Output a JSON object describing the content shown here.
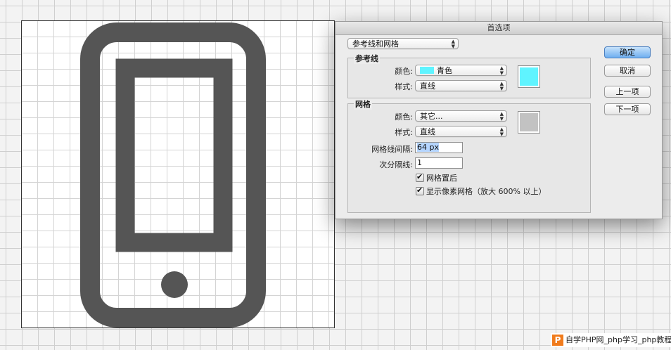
{
  "dialog": {
    "title": "首选项",
    "section_select": "参考线和网格",
    "guides": {
      "title": "参考线",
      "color_label": "颜色:",
      "color_value": "青色",
      "color_swatch": "#5ff4ff",
      "style_label": "样式:",
      "style_value": "直线"
    },
    "grid": {
      "title": "网格",
      "color_label": "颜色:",
      "color_value": "其它...",
      "color_swatch": "#c2c2c2",
      "style_label": "样式:",
      "style_value": "直线",
      "spacing_label": "网格线间隔:",
      "spacing_value": "64 px",
      "subdiv_label": "次分隔线:",
      "subdiv_value": "1",
      "behind_label": "网格置后",
      "pixel_grid_label": "显示像素网格（放大 600% 以上）"
    },
    "buttons": {
      "ok": "确定",
      "cancel": "取消",
      "prev": "上一项",
      "next": "下一项"
    }
  },
  "canvas": {
    "icon": "smartphone-icon",
    "icon_color": "#555555"
  },
  "watermark": {
    "logo": "P",
    "text": "自学PHP网_php学习_php教程"
  }
}
